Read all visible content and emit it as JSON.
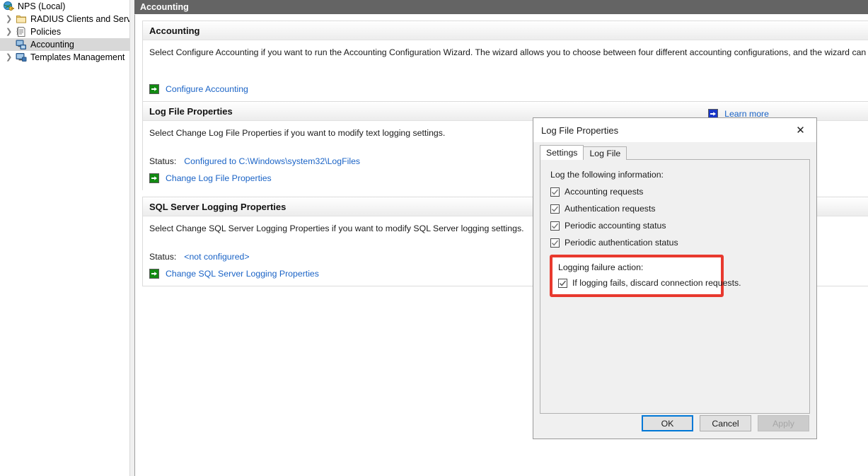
{
  "tree": {
    "items": [
      {
        "label": "NPS (Local)",
        "icon": "globe-key-icon",
        "level": 0,
        "expandable": false,
        "selected": false
      },
      {
        "label": "RADIUS Clients and Servers",
        "icon": "folder-icon",
        "level": 1,
        "expandable": true,
        "selected": false
      },
      {
        "label": "Policies",
        "icon": "document-icon",
        "level": 1,
        "expandable": true,
        "selected": false
      },
      {
        "label": "Accounting",
        "icon": "accounting-icon",
        "level": 1,
        "expandable": false,
        "selected": true
      },
      {
        "label": "Templates Management",
        "icon": "monitor-icon",
        "level": 1,
        "expandable": true,
        "selected": false
      }
    ]
  },
  "header": {
    "title": "Accounting"
  },
  "sections": [
    {
      "title": "Accounting",
      "description": "Select Configure Accounting if you want to run the Accounting Configuration Wizard. The wizard allows you to choose between four different accounting configurations, and the wizard can automatically configure a loc",
      "link_label": "Configure Accounting",
      "link_icon": "green-arrow-icon"
    },
    {
      "title": "Log File Properties",
      "description": "Select Change Log File Properties if you want to modify text logging settings.",
      "status_label": "Status:",
      "status_value": "Configured to C:\\Windows\\system32\\LogFiles",
      "link_label": "Change Log File Properties",
      "link_icon": "green-arrow-icon"
    },
    {
      "title": "SQL Server Logging Properties",
      "description": "Select Change SQL Server Logging Properties if you want to modify SQL Server logging settings.",
      "status_label": "Status:",
      "status_value": "<not configured>",
      "link_label": "Change SQL Server Logging Properties",
      "link_icon": "green-arrow-icon"
    }
  ],
  "learn_more": {
    "label": "Learn more",
    "icon": "blue-arrow-icon"
  },
  "dialog": {
    "title": "Log File Properties",
    "close_icon": "close-icon",
    "tabs": [
      {
        "label": "Settings",
        "active": true
      },
      {
        "label": "Log File",
        "active": false
      }
    ],
    "settings": {
      "group_label": "Log the following information:",
      "checkboxes": [
        {
          "label": "Accounting requests",
          "checked": true
        },
        {
          "label": "Authentication requests",
          "checked": true
        },
        {
          "label": "Periodic accounting status",
          "checked": true
        },
        {
          "label": "Periodic authentication status",
          "checked": true
        }
      ],
      "failure_group": {
        "label": "Logging failure action:",
        "checkbox": {
          "label": "If logging fails, discard connection requests.",
          "checked": true
        },
        "highlight_color": "#e8392e"
      }
    },
    "buttons": [
      {
        "label": "OK",
        "state": "default"
      },
      {
        "label": "Cancel",
        "state": "normal"
      },
      {
        "label": "Apply",
        "state": "disabled"
      }
    ]
  },
  "colors": {
    "link": "#1a63c6",
    "header_bar": "#646464",
    "green_icon": "#128a12",
    "blue_icon": "#1836c8",
    "focus_blue": "#0078d7",
    "highlight_red": "#e8392e"
  }
}
